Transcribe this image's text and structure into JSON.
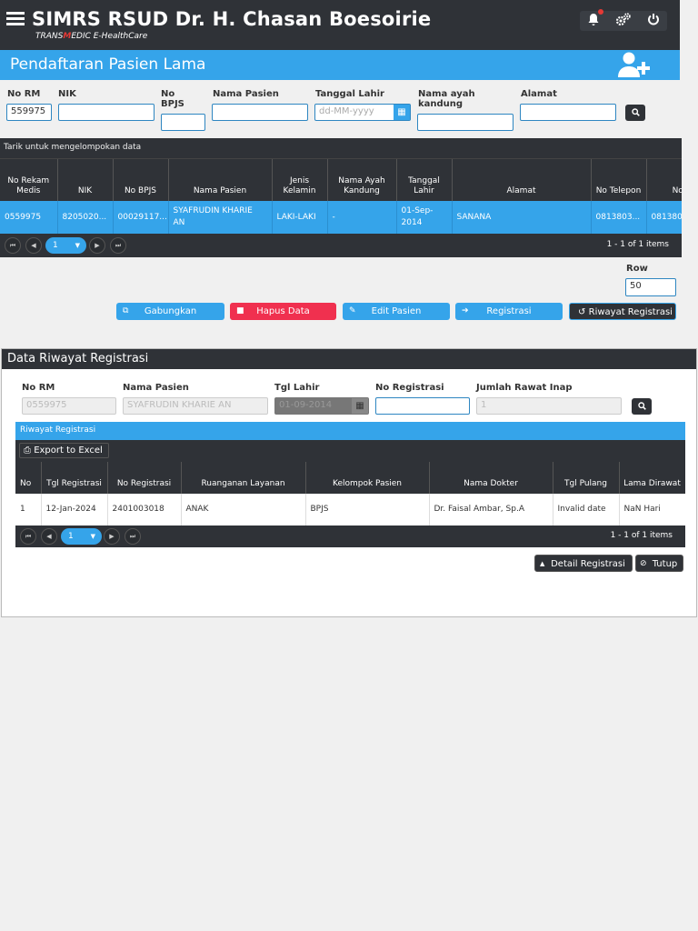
{
  "header": {
    "title": "SIMRS RSUD Dr. H. Chasan Boesoirie",
    "subtitle_pre": "TRANS",
    "subtitle_m": "M",
    "subtitle_post": "EDIC E-HealthCare"
  },
  "page_title": "Pendaftaran Pasien Lama",
  "search": {
    "no_rm_label": "No RM",
    "no_rm_value": "559975",
    "nik_label": "NIK",
    "no_bpjs_label": "No BPJS",
    "nama_pasien_label": "Nama Pasien",
    "tanggal_lahir_label": "Tanggal Lahir",
    "tanggal_lahir_placeholder": "dd-MM-yyyy",
    "nama_ayah_label": "Nama ayah kandung",
    "alamat_label": "Alamat"
  },
  "patient_grid": {
    "group_hint": "Tarik untuk mengelompokan data",
    "columns": [
      "No Rekam Medis",
      "NIK",
      "No BPJS",
      "Nama Pasien",
      "Jenis Kelamin",
      "Nama Ayah Kandung",
      "Tanggal Lahir",
      "Alamat",
      "No Telepon",
      "No H"
    ],
    "row": [
      "0559975",
      "8205020...",
      "00029117...",
      "SYAFRUDIN KHARIE AN",
      "LAKI-LAKI",
      "-",
      "01-Sep-2014",
      "SANANA",
      "0813803...",
      "081380"
    ],
    "page": "1",
    "page_info": "1 - 1 of 1 items"
  },
  "row_label": "Row",
  "row_value": "50",
  "actions": {
    "gabungkan": "Gabungkan",
    "hapus": "Hapus Data",
    "edit": "Edit Pasien",
    "registrasi": "Registrasi",
    "riwayat": "Riwayat Registrasi"
  },
  "riwayat_panel": {
    "title": "Data Riwayat Registrasi",
    "no_rm_label": "No RM",
    "no_rm_value": "0559975",
    "nama_label": "Nama Pasien",
    "nama_value": "SYAFRUDIN KHARIE AN",
    "tgl_lahir_label": "Tgl Lahir",
    "tgl_lahir_value": "01-09-2014",
    "no_reg_label": "No Registrasi",
    "jumlah_label": "Jumlah Rawat Inap",
    "jumlah_value": "1",
    "strip_title": "Riwayat Registrasi",
    "export": "Export to Excel",
    "columns": [
      "No",
      "Tgl Registrasi",
      "No Registrasi",
      "Ruanganan Layanan",
      "Kelompok Pasien",
      "Nama Dokter",
      "Tgl Pulang",
      "Lama Dirawat"
    ],
    "row": [
      "1",
      "12-Jan-2024",
      "2401003018",
      "ANAK",
      "BPJS",
      "Dr. Faisal Ambar, Sp.A",
      "Invalid date",
      "NaN Hari"
    ],
    "page": "1",
    "page_info": "1 - 1 of 1 items",
    "detail_btn": "Detail Registrasi",
    "tutup_btn": "Tutup"
  },
  "icons": {
    "menu": "menu-icon",
    "bell": "bell-icon",
    "settings": "gears-icon",
    "power": "power-icon",
    "add_user": "add-user-icon",
    "calendar": "calendar-icon",
    "search": "search-icon"
  },
  "colors": {
    "header_dark": "#2f3237",
    "accent_blue": "#35a4ea",
    "danger_red": "#f0304f",
    "notification_dot": "#e53935"
  }
}
